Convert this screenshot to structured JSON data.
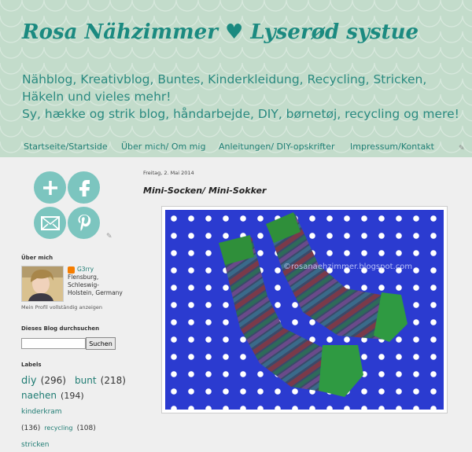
{
  "header": {
    "title": "Rosa Nähzimmer ♥ Lyserød systue",
    "description_line1": "Nähblog, Kreativblog, Buntes, Kinderkleidung, Recycling, Stricken, Häkeln und vieles mehr!",
    "description_line2": "Sy, hække og strik blog, håndarbejde, DIY, børnetøj, recycling og mere!"
  },
  "nav": [
    {
      "label": "Startseite/Startside"
    },
    {
      "label": "Über mich/ Om mig"
    },
    {
      "label": "Anleitungen/ DIY-opskrifter"
    },
    {
      "label": "Impressum/Kontakt"
    }
  ],
  "sidebar": {
    "social_icons": [
      "plus-icon",
      "facebook-icon",
      "mail-icon",
      "pinterest-icon"
    ],
    "about_heading": "Über mich",
    "profile_name": "G3rry",
    "profile_location": [
      "Flensburg,",
      "Schleswig-",
      "Holstein, Germany"
    ],
    "profile_link": "Mein Profil vollständig anzeigen",
    "search_heading": "Dieses Blog durchsuchen",
    "search_button": "Suchen",
    "labels_heading": "Labels",
    "labels": [
      {
        "name": "diy",
        "count": "(296)"
      },
      {
        "name": "bunt",
        "count": "(218)"
      },
      {
        "name": "naehen",
        "count": "(194)"
      },
      {
        "name": "kinderkram",
        "count": ""
      },
      {
        "name": "",
        "count": "(136)"
      },
      {
        "name": "recycling",
        "count": "(108)"
      },
      {
        "name": "stricken",
        "count": ""
      }
    ]
  },
  "post": {
    "date": "Freitag, 2. Mai 2014",
    "title": "Mini-Socken/ Mini-Sokker",
    "watermark": "©rosanaehzimmer.blogspot.com"
  },
  "colors": {
    "header_bg": "#c3dccb",
    "title": "#1b8a80",
    "social": "#7cc5bf",
    "photo_bg": "#2b3bd0"
  }
}
